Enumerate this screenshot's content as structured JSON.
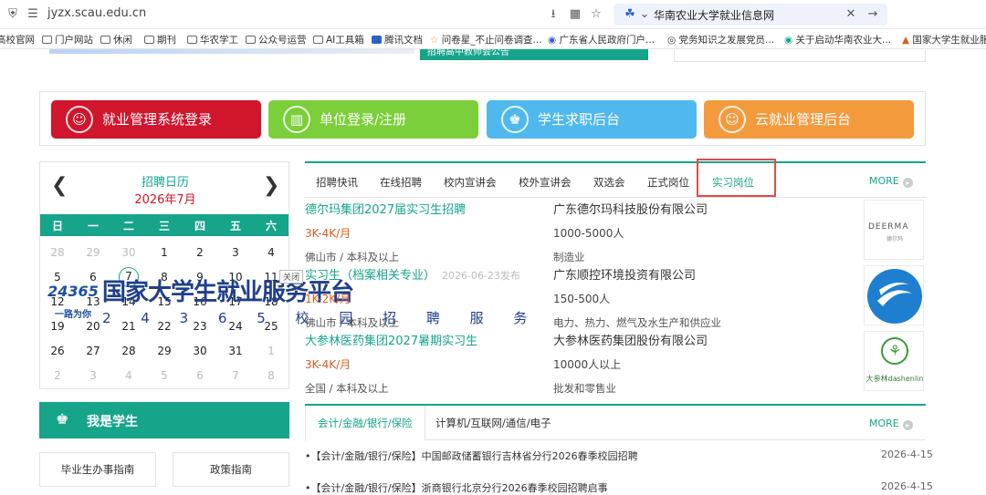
{
  "browser": {
    "url": "jyzx.scau.edu.cn",
    "tab_title": "华南农业大学就业信息网",
    "bookmarks": [
      "高校官网",
      "门户网站",
      "休闲",
      "期刊",
      "华农学工",
      "公众号运营",
      "AI工具箱",
      "腾讯文档",
      "问卷星_不止问卷调查...",
      "广东省人民政府门户...",
      "党务知识之发展党员...",
      "关于启动华南农业大...",
      "国家大学生就业服"
    ]
  },
  "top_strip": {
    "partial_text": "招聘高中教师会公告"
  },
  "nav_buttons": [
    {
      "label": "就业管理系统登录",
      "color": "#d0152c",
      "icon": "user-icon"
    },
    {
      "label": "单位登录/注册",
      "color": "#7bcf3a",
      "icon": "building-icon"
    },
    {
      "label": "学生求职后台",
      "color": "#4fb8ee",
      "icon": "graduate-icon"
    },
    {
      "label": "云就业管理后台",
      "color": "#f39a3d",
      "icon": "user-icon"
    }
  ],
  "calendar": {
    "title": "招聘日历",
    "month": "2026年7月",
    "weekdays": [
      "日",
      "一",
      "二",
      "三",
      "四",
      "五",
      "六"
    ],
    "weeks": [
      [
        "28",
        "29",
        "30",
        "1",
        "2",
        "3",
        "4"
      ],
      [
        "5",
        "6",
        "7",
        "8",
        "9",
        "10",
        "11"
      ],
      [
        "12",
        "13",
        "14",
        "15",
        "16",
        "17",
        "18"
      ],
      [
        "19",
        "20",
        "21",
        "22",
        "23",
        "24",
        "25"
      ],
      [
        "26",
        "27",
        "28",
        "29",
        "30",
        "31",
        "1"
      ],
      [
        "2",
        "3",
        "4",
        "5",
        "6",
        "7",
        "8"
      ]
    ]
  },
  "ad_banner": {
    "logo_text": "24365",
    "logo_sub": "一路为你",
    "title": "国家大学生就业服务平台",
    "subtitle": "2 4 3 6 5 校 园 招 聘 服 务",
    "close_label": "关闭"
  },
  "student_section": {
    "title": "我是学生",
    "buttons": [
      "毕业生办事指南",
      "政策指南"
    ]
  },
  "job_tabs": [
    "招聘快讯",
    "在线招聘",
    "校内宣讲会",
    "校外宣讲会",
    "双选会",
    "正式岗位",
    "实习岗位"
  ],
  "job_tabs_active": "实习岗位",
  "more_label": "MORE",
  "jobs": [
    {
      "title": "德尔玛集团2027届实习生招聘",
      "date": "",
      "salary": "3K-4K/月",
      "location": "佛山市 / 本科及以上",
      "company": "广东德尔玛科技股份有限公司",
      "size": "1000-5000人",
      "industry": "制造业",
      "logo_text": "DEERMA",
      "logo_sub": "德尔玛"
    },
    {
      "title": "实习生（档案相关专业）",
      "date": "2026-06-23发布",
      "salary": "1K-2K/月",
      "location": "佛山市 / 本科及以上",
      "company": "广东顺控环境投资有限公司",
      "size": "150-500人",
      "industry": "电力、热力、燃气及水生产和供应业",
      "logo_text": "",
      "logo_sub": ""
    },
    {
      "title": "大参林医药集团2027暑期实习生",
      "date": "",
      "salary": "3K-4K/月",
      "location": "全国 / 本科及以上",
      "company": "大参林医药集团股份有限公司",
      "size": "10000人以上",
      "industry": "批发和零售业",
      "logo_text": "大参林dashenlin",
      "logo_sub": ""
    }
  ],
  "news_tabs": [
    "会计/金融/银行/保险",
    "计算机/互联网/通信/电子"
  ],
  "news_tabs_active": "会计/金融/银行/保险",
  "news": [
    {
      "text": "•【会计/金融/银行/保险】中国邮政储蓄银行吉林省分行2026春季校园招聘",
      "date": "2026-4-15"
    },
    {
      "text": "•【会计/金融/银行/保险】浙商银行北京分行2026春季校园招聘启事",
      "date": "2026-4-15"
    }
  ],
  "colors": {
    "accent": "#16a48b",
    "salary": "#e05a1c",
    "highlight_box": "#e24b4b"
  }
}
